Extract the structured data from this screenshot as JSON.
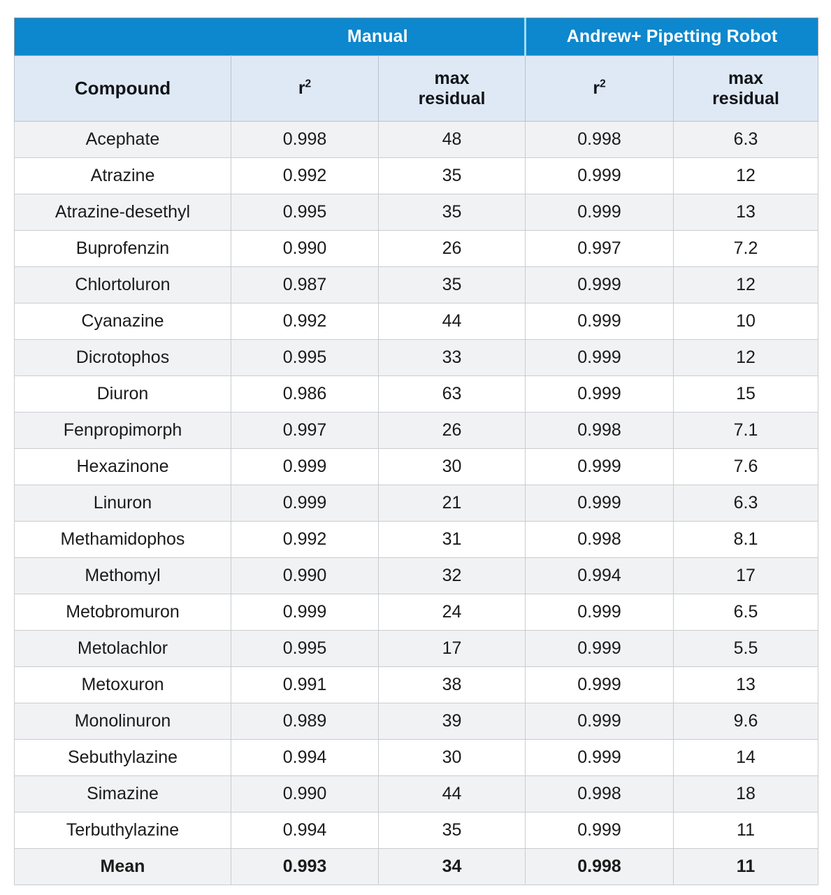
{
  "table": {
    "group_headers": [
      {
        "label": "",
        "span": 1
      },
      {
        "label": "Manual",
        "span": 2
      },
      {
        "label": "Andrew+ Pipetting Robot",
        "span": 2
      }
    ],
    "column_headers": [
      {
        "label": "Compound"
      },
      {
        "label": "r",
        "sup": "2"
      },
      {
        "label": "max\nresidual",
        "line1": "max",
        "line2": "residual"
      },
      {
        "label": "r",
        "sup": "2"
      },
      {
        "label": "max\nresidual",
        "line1": "max",
        "line2": "residual"
      }
    ],
    "rows": [
      {
        "compound": "Acephate",
        "manual_r2": "0.998",
        "manual_max_residual": "48",
        "robot_r2": "0.998",
        "robot_max_residual": "6.3"
      },
      {
        "compound": "Atrazine",
        "manual_r2": "0.992",
        "manual_max_residual": "35",
        "robot_r2": "0.999",
        "robot_max_residual": "12"
      },
      {
        "compound": "Atrazine-desethyl",
        "manual_r2": "0.995",
        "manual_max_residual": "35",
        "robot_r2": "0.999",
        "robot_max_residual": "13"
      },
      {
        "compound": "Buprofenzin",
        "manual_r2": "0.990",
        "manual_max_residual": "26",
        "robot_r2": "0.997",
        "robot_max_residual": "7.2"
      },
      {
        "compound": "Chlortoluron",
        "manual_r2": "0.987",
        "manual_max_residual": "35",
        "robot_r2": "0.999",
        "robot_max_residual": "12"
      },
      {
        "compound": "Cyanazine",
        "manual_r2": "0.992",
        "manual_max_residual": "44",
        "robot_r2": "0.999",
        "robot_max_residual": "10"
      },
      {
        "compound": "Dicrotophos",
        "manual_r2": "0.995",
        "manual_max_residual": "33",
        "robot_r2": "0.999",
        "robot_max_residual": "12"
      },
      {
        "compound": "Diuron",
        "manual_r2": "0.986",
        "manual_max_residual": "63",
        "robot_r2": "0.999",
        "robot_max_residual": "15"
      },
      {
        "compound": "Fenpropimorph",
        "manual_r2": "0.997",
        "manual_max_residual": "26",
        "robot_r2": "0.998",
        "robot_max_residual": "7.1"
      },
      {
        "compound": "Hexazinone",
        "manual_r2": "0.999",
        "manual_max_residual": "30",
        "robot_r2": "0.999",
        "robot_max_residual": "7.6"
      },
      {
        "compound": "Linuron",
        "manual_r2": "0.999",
        "manual_max_residual": "21",
        "robot_r2": "0.999",
        "robot_max_residual": "6.3"
      },
      {
        "compound": "Methamidophos",
        "manual_r2": "0.992",
        "manual_max_residual": "31",
        "robot_r2": "0.998",
        "robot_max_residual": "8.1"
      },
      {
        "compound": "Methomyl",
        "manual_r2": "0.990",
        "manual_max_residual": "32",
        "robot_r2": "0.994",
        "robot_max_residual": "17"
      },
      {
        "compound": "Metobromuron",
        "manual_r2": "0.999",
        "manual_max_residual": "24",
        "robot_r2": "0.999",
        "robot_max_residual": "6.5"
      },
      {
        "compound": "Metolachlor",
        "manual_r2": "0.995",
        "manual_max_residual": "17",
        "robot_r2": "0.999",
        "robot_max_residual": "5.5"
      },
      {
        "compound": "Metoxuron",
        "manual_r2": "0.991",
        "manual_max_residual": "38",
        "robot_r2": "0.999",
        "robot_max_residual": "13"
      },
      {
        "compound": "Monolinuron",
        "manual_r2": "0.989",
        "manual_max_residual": "39",
        "robot_r2": "0.999",
        "robot_max_residual": "9.6"
      },
      {
        "compound": "Sebuthylazine",
        "manual_r2": "0.994",
        "manual_max_residual": "30",
        "robot_r2": "0.999",
        "robot_max_residual": "14"
      },
      {
        "compound": "Simazine",
        "manual_r2": "0.990",
        "manual_max_residual": "44",
        "robot_r2": "0.998",
        "robot_max_residual": "18"
      },
      {
        "compound": "Terbuthylazine",
        "manual_r2": "0.994",
        "manual_max_residual": "35",
        "robot_r2": "0.999",
        "robot_max_residual": "11"
      }
    ],
    "summary_row": {
      "compound": "Mean",
      "manual_r2": "0.993",
      "manual_max_residual": "34",
      "robot_r2": "0.998",
      "robot_max_residual": "11"
    }
  },
  "colors": {
    "header_blue": "#0d87cd",
    "subheader_blue": "#dfe9f5",
    "row_stripe": "#f1f2f4",
    "row_plain": "#ffffff",
    "grid_line": "#c9ccd0"
  }
}
